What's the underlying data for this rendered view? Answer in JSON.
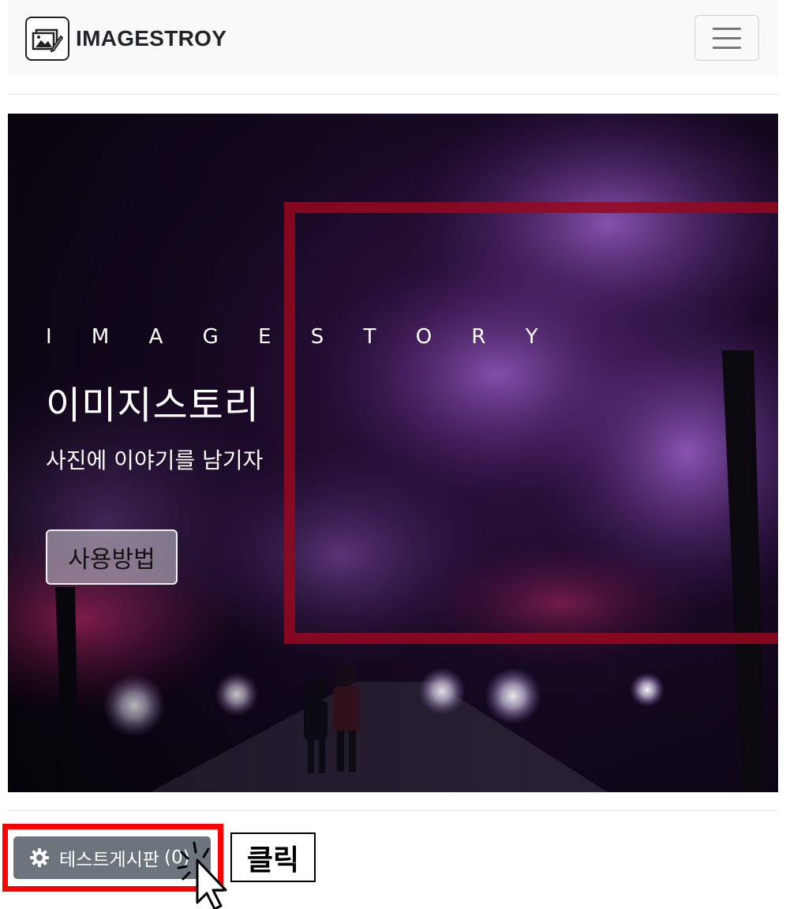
{
  "navbar": {
    "brand": "IMAGESTROY",
    "logo_icon": "image-gallery-icon",
    "menu_icon": "hamburger-icon"
  },
  "hero": {
    "eyebrow": "I M A G E S T O R Y",
    "title": "이미지스토리",
    "subtitle": "사진에 이야기를 남기자",
    "button_label": "사용방법"
  },
  "board_button": {
    "icon": "gear-icon",
    "label": "테스트게시판",
    "count": "(0)"
  },
  "annotation": {
    "click_label": "클릭",
    "highlight_color": "#ff0000"
  },
  "colors": {
    "navbar_bg": "#f8f9fa",
    "button_secondary": "#6c757d"
  }
}
